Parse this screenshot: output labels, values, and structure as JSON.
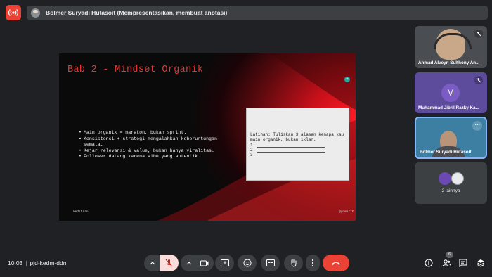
{
  "top_bar": {
    "presenter_text": "Bolmer Suryadi Hutasoit (Mempresentasikan, membuat anotasi)"
  },
  "slide": {
    "title": "Bab 2 - Mindset Organik",
    "bullets": [
      "Main organik = maraton, bukan sprint.",
      "Konsistensi + strategi mengalahkan keberuntungan semata.",
      "Kejar relevansi & value, bukan hanya viralitas.",
      "Follower datang karena vibe yang autentik."
    ],
    "exercise": {
      "prompt": "Latihan: Tuliskan 3 alasan kenapa kau main organik, bukan iklan.",
      "numbers": [
        "1.",
        "2.",
        "3."
      ]
    },
    "footer_left": "keditaan",
    "footer_right": "@yomartb"
  },
  "participants": [
    {
      "name": "Ahmad Alveyn Sulthony An...",
      "muted": true
    },
    {
      "name": "Muhammad Jibril Razky Ka...",
      "initial": "M",
      "muted": true
    },
    {
      "name": "Bolmer Suryadi Hutasoit"
    },
    {
      "label": "2 lainnya"
    }
  ],
  "bottom_bar": {
    "time": "10.03",
    "meeting_code": "pjd-kedm-ddn",
    "people_count": "6"
  },
  "colors": {
    "background": "#202124",
    "accent_red": "#ea4335",
    "tile_purple": "#5d4b9c",
    "active_border": "#8ab4f8"
  }
}
